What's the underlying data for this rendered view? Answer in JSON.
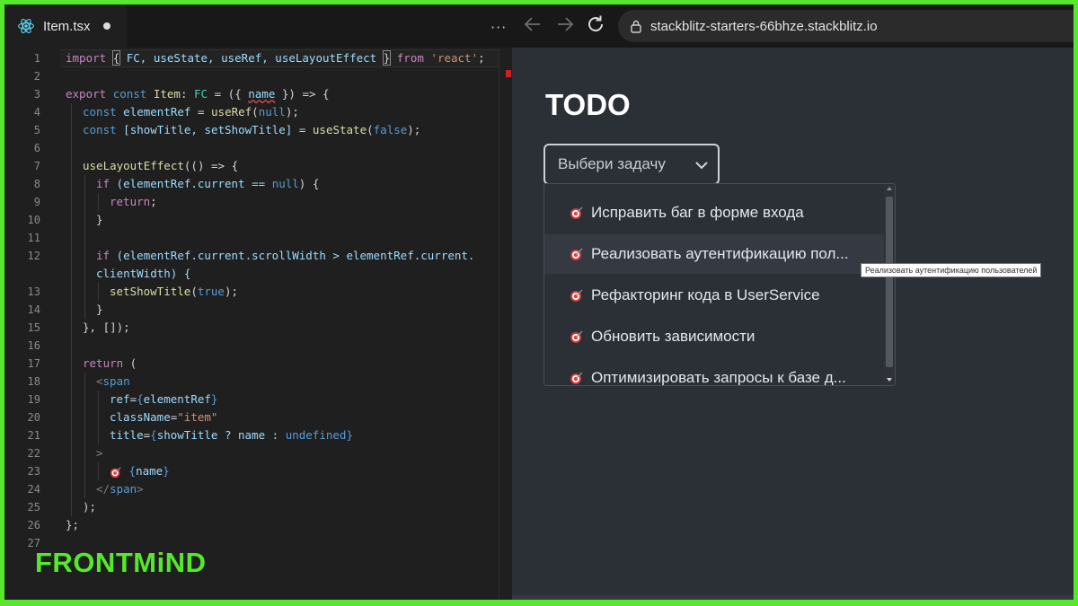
{
  "editor_tab": {
    "filename": "Item.tsx"
  },
  "browser": {
    "url": "stackblitz-starters-66bhze.stackblitz.io"
  },
  "code_lines": [
    {
      "n": "1"
    },
    {
      "n": "2"
    },
    {
      "n": "3"
    },
    {
      "n": "4"
    },
    {
      "n": "5"
    },
    {
      "n": "6"
    },
    {
      "n": "7"
    },
    {
      "n": "8"
    },
    {
      "n": "9"
    },
    {
      "n": "10"
    },
    {
      "n": "11"
    },
    {
      "n": "12"
    },
    {
      "n": "13"
    },
    {
      "n": "14"
    },
    {
      "n": "15"
    },
    {
      "n": "16"
    },
    {
      "n": "17"
    },
    {
      "n": "18"
    },
    {
      "n": "19"
    },
    {
      "n": "20"
    },
    {
      "n": "21"
    },
    {
      "n": "22"
    },
    {
      "n": "23"
    },
    {
      "n": "24"
    },
    {
      "n": "25"
    },
    {
      "n": "26"
    },
    {
      "n": "27"
    }
  ],
  "code": {
    "l1": {
      "import": "import",
      "open": "{",
      "names": " FC, useState, useRef, useLayoutEffect ",
      "close": "}",
      "from": "from",
      "mod": "'react'",
      "semi": ";"
    },
    "l3": {
      "export": "export",
      "const": "const",
      "id": "Item",
      "colon": ":",
      "type": "FC",
      "rest": " = ({ ",
      "param": "name",
      "tail": " }) => {"
    },
    "l4": {
      "const": "const",
      "id": "elementRef",
      "eq": " = ",
      "fn": "useRef",
      "open": "(",
      "val": "null",
      "close": ");"
    },
    "l5": {
      "const": "const",
      "pattern": " [showTitle, setShowTitle] = ",
      "fn": "useState",
      "open": "(",
      "val": "false",
      "close": ");"
    },
    "l7": {
      "fn": "useLayoutEffect",
      "rest": "(() => {"
    },
    "l8": {
      "if": "if",
      "rest": " (elementRef.current == ",
      "val": "null",
      "tail": ") {"
    },
    "l9": {
      "ret": "return",
      "semi": ";"
    },
    "l10": {
      "text": "}"
    },
    "l12a": {
      "if": "if",
      "rest": " (elementRef.current.scrollWidth > elementRef.current."
    },
    "l12b": {
      "text": "clientWidth) {"
    },
    "l13": {
      "fn": "setShowTitle",
      "open": "(",
      "val": "true",
      "close": ");"
    },
    "l14": {
      "text": "}"
    },
    "l15": {
      "text": "}, []);"
    },
    "l17": {
      "ret": "return",
      "rest": " ("
    },
    "l18": {
      "lt": "<",
      "tag": "span"
    },
    "l19": {
      "attr": "ref",
      "eq": "=",
      "open": "{",
      "val": "elementRef",
      "close": "}"
    },
    "l20": {
      "attr": "className",
      "eq": "=",
      "val": "\"item\""
    },
    "l21": {
      "attr": "title",
      "eq": "=",
      "open": "{",
      "val": "showTitle ? name : ",
      "undef": "undefined",
      "close": "}"
    },
    "l22": {
      "text": ">"
    },
    "l23": {
      "open": " {",
      "val": "name",
      "close": "}"
    },
    "l24": {
      "lt": "</",
      "tag": "span",
      "gt": ">"
    },
    "l25": {
      "text": ");"
    },
    "l26": {
      "text": "};"
    }
  },
  "brand": {
    "name": "FRONTMiND"
  },
  "preview": {
    "title": "TODO",
    "select": {
      "placeholder": "Выбери задачу"
    },
    "options": [
      {
        "label": "Исправить баг в форме входа"
      },
      {
        "label": "Реализовать аутентификацию пол..."
      },
      {
        "label": "Рефакторинг кода в UserService"
      },
      {
        "label": "Обновить зависимости"
      },
      {
        "label": "Оптимизировать запросы к базе д..."
      }
    ],
    "tooltip": "Реализовать аутентификацию пользователей"
  },
  "colors": {
    "border": "#56e82a",
    "editor_bg": "#1f1f1f",
    "preview_bg": "#2b2f36",
    "brand": "#56e82a",
    "error_mark": "#d21e1e"
  }
}
